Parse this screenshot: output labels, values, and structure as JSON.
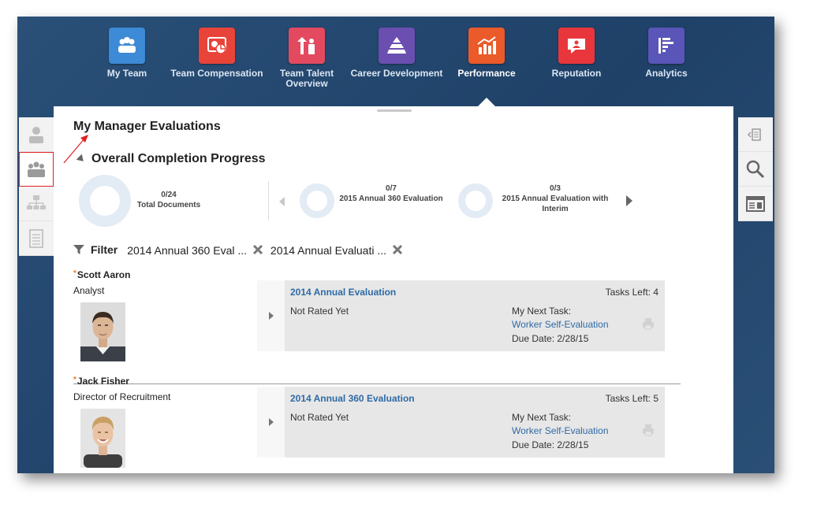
{
  "nav": {
    "items": [
      {
        "label": "My Team",
        "color": "#3d8ad6",
        "icon": "team-icon"
      },
      {
        "label": "Team Compensation",
        "color": "#e8443a",
        "icon": "compensation-icon"
      },
      {
        "label": "Team Talent Overview",
        "color": "#e34a60",
        "icon": "talent-icon"
      },
      {
        "label": "Career Development",
        "color": "#6a4fb0",
        "icon": "career-pyramid-icon"
      },
      {
        "label": "Performance",
        "color": "#ea5a2a",
        "icon": "performance-chart-icon"
      },
      {
        "label": "Reputation",
        "color": "#e8363c",
        "icon": "reputation-icon"
      },
      {
        "label": "Analytics",
        "color": "#5a55b8",
        "icon": "analytics-icon"
      }
    ],
    "active": "Performance"
  },
  "left_strip": {
    "items": [
      "person-icon",
      "group-icon",
      "org-chart-icon",
      "document-icon"
    ],
    "selected": "group-icon"
  },
  "right_strip": {
    "items": [
      "collapse-panel-icon",
      "search-icon",
      "dashboard-icon"
    ]
  },
  "page": {
    "title": "My Manager Evaluations",
    "section_title": "Overall Completion Progress"
  },
  "progress": {
    "total": {
      "count": "0/24",
      "label": "Total Documents"
    },
    "docs": [
      {
        "count": "0/7",
        "label": "2015 Annual 360 Evaluation"
      },
      {
        "count": "0/3",
        "label": "2015 Annual Evaluation with Interim"
      }
    ]
  },
  "filter": {
    "label": "Filter",
    "chips": [
      "2014 Annual 360 Eval ...",
      "2014 Annual Evaluati ..."
    ]
  },
  "employees": [
    {
      "name": "Scott Aaron",
      "role": "Analyst",
      "evaluation": "2014 Annual Evaluation",
      "tasks_left": "Tasks Left:  4",
      "status": "Not Rated Yet",
      "next_task_label": "My Next Task:",
      "next_task": "Worker Self-Evaluation",
      "due_date": "Due Date:  2/28/15"
    },
    {
      "name": "Jack Fisher",
      "role": "Director of Recruitment",
      "evaluation": "2014 Annual 360 Evaluation",
      "tasks_left": "Tasks Left:  5",
      "status": "Not Rated Yet",
      "next_task_label": "My Next Task:",
      "next_task": "Worker Self-Evaluation",
      "due_date": "Due Date:  2/28/15"
    }
  ],
  "colors": {
    "link": "#2e6aa6",
    "required_marker": "#e87722",
    "annotation_arrow": "#e02020"
  }
}
